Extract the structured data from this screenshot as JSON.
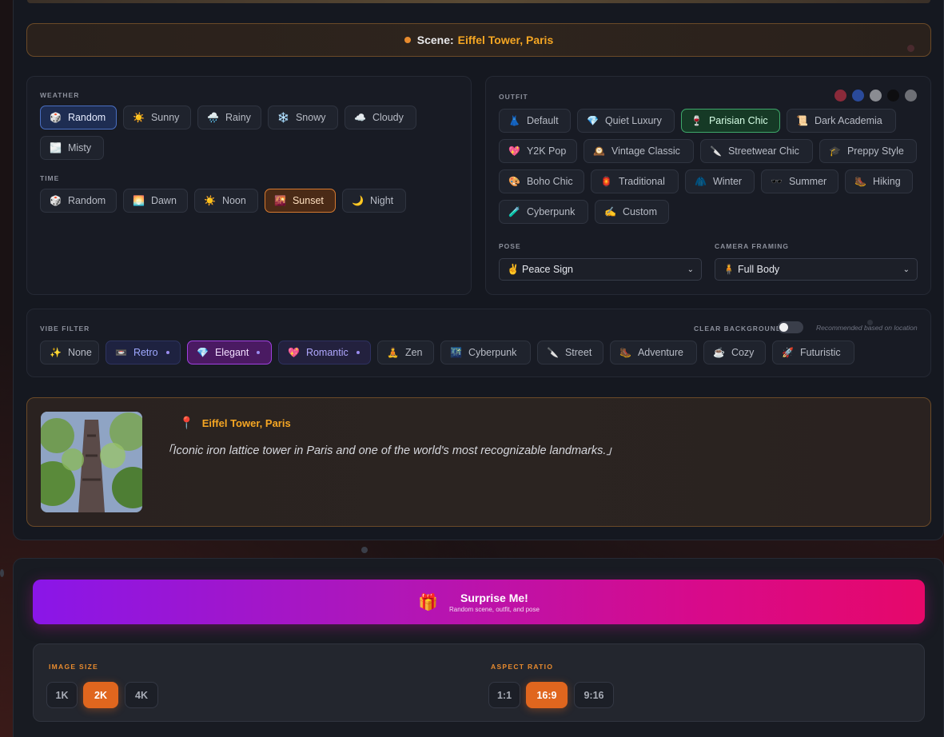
{
  "scene": {
    "label": "Scene:",
    "value": "Eiffel Tower, Paris"
  },
  "weather": {
    "label": "WEATHER",
    "options": [
      {
        "icon": "🎲",
        "label": "Random"
      },
      {
        "icon": "☀️",
        "label": "Sunny"
      },
      {
        "icon": "🌧️",
        "label": "Rainy"
      },
      {
        "icon": "❄️",
        "label": "Snowy"
      },
      {
        "icon": "☁️",
        "label": "Cloudy"
      },
      {
        "icon": "🌫️",
        "label": "Misty"
      }
    ],
    "selected": "Random"
  },
  "time": {
    "label": "TIME",
    "options": [
      {
        "icon": "🎲",
        "label": "Random"
      },
      {
        "icon": "🌅",
        "label": "Dawn"
      },
      {
        "icon": "☀️",
        "label": "Noon"
      },
      {
        "icon": "🌇",
        "label": "Sunset"
      },
      {
        "icon": "🌙",
        "label": "Night"
      }
    ],
    "selected": "Sunset"
  },
  "outfit": {
    "label": "OUTFIT",
    "swatches": [
      "#8a2a3a",
      "#2a4a9a",
      "#8a8c92",
      "#0e0e10",
      "#6e7076"
    ],
    "options": [
      {
        "icon": "👗",
        "label": "Default"
      },
      {
        "icon": "💎",
        "label": "Quiet Luxury"
      },
      {
        "icon": "🍷",
        "label": "Parisian Chic"
      },
      {
        "icon": "📜",
        "label": "Dark Academia"
      },
      {
        "icon": "💖",
        "label": "Y2K Pop"
      },
      {
        "icon": "🕰️",
        "label": "Vintage Classic"
      },
      {
        "icon": "🔪",
        "label": "Streetwear Chic"
      },
      {
        "icon": "🎓",
        "label": "Preppy Style"
      },
      {
        "icon": "🎨",
        "label": "Boho Chic"
      },
      {
        "icon": "🏮",
        "label": "Traditional"
      },
      {
        "icon": "🧥",
        "label": "Winter"
      },
      {
        "icon": "🕶️",
        "label": "Summer"
      },
      {
        "icon": "🥾",
        "label": "Hiking"
      },
      {
        "icon": "🧪",
        "label": "Cyberpunk"
      },
      {
        "icon": "✍️",
        "label": "Custom"
      }
    ],
    "selected": "Parisian Chic"
  },
  "pose": {
    "label": "POSE",
    "value": "✌️ Peace Sign"
  },
  "framing": {
    "label": "CAMERA FRAMING",
    "value": "🧍 Full Body"
  },
  "vibe": {
    "label": "VIBE FILTER",
    "clear_bg_label": "CLEAR BACKGROUND",
    "recommended_note": "Recommended based on location",
    "options": [
      {
        "icon": "✨",
        "label": "None"
      },
      {
        "icon": "📼",
        "label": "Retro"
      },
      {
        "icon": "💎",
        "label": "Elegant"
      },
      {
        "icon": "💖",
        "label": "Romantic"
      },
      {
        "icon": "🧘",
        "label": "Zen"
      },
      {
        "icon": "🌃",
        "label": "Cyberpunk"
      },
      {
        "icon": "🔪",
        "label": "Street"
      },
      {
        "icon": "🥾",
        "label": "Adventure"
      },
      {
        "icon": "☕",
        "label": "Cozy"
      },
      {
        "icon": "🚀",
        "label": "Futuristic"
      }
    ],
    "selected": "Elegant",
    "recommended": [
      "Retro",
      "Elegant",
      "Romantic"
    ]
  },
  "location": {
    "title": "Eiffel Tower, Paris",
    "description": "「Iconic iron lattice tower in Paris and one of the world's most recognizable landmarks.」"
  },
  "surprise": {
    "title": "Surprise Me!",
    "subtitle": "Random scene, outfit, and pose"
  },
  "image_size": {
    "label": "IMAGE SIZE",
    "options": [
      "1K",
      "2K",
      "4K"
    ],
    "selected": "2K"
  },
  "aspect_ratio": {
    "label": "ASPECT RATIO",
    "options": [
      "1:1",
      "16:9",
      "9:16"
    ],
    "selected": "16:9"
  }
}
